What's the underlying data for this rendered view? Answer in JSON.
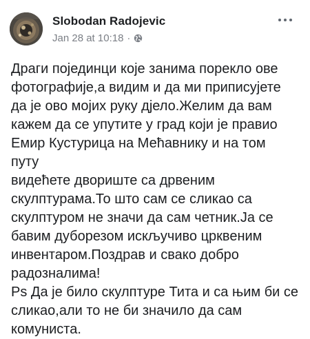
{
  "post": {
    "author": "Slobodan Radojevic",
    "timestamp": "Jan 28 at 10:18",
    "separator": "·",
    "privacy_icon": "globe-icon",
    "more_icon": "more-options-icon",
    "lines": [
      "Драги појединци које занима порекло ове",
      "фотографије,а видим и да ми приписујете",
      "да је ово мојих руку дјело.Желим да вам",
      "кажем да се упутите у град који је правио",
      "Емир Кустурица на Мећавнику и на том",
      "путу",
      "видећете двориште са дрвеним",
      "скулптурама.То што сам се сликао са",
      "скулптуром не значи да сам четник.Ја се",
      "бавим дуборезом искључиво црквеним",
      "инвентаром.Поздрав и свако добро",
      "радозналима!",
      "Ps Да је било скулптуре Тита и са њим би се",
      "сликао,али то не би значило да сам",
      "комуниста."
    ]
  },
  "colors": {
    "text": "#1c1e21",
    "meta": "#7b7f86",
    "background": "#ffffff"
  }
}
